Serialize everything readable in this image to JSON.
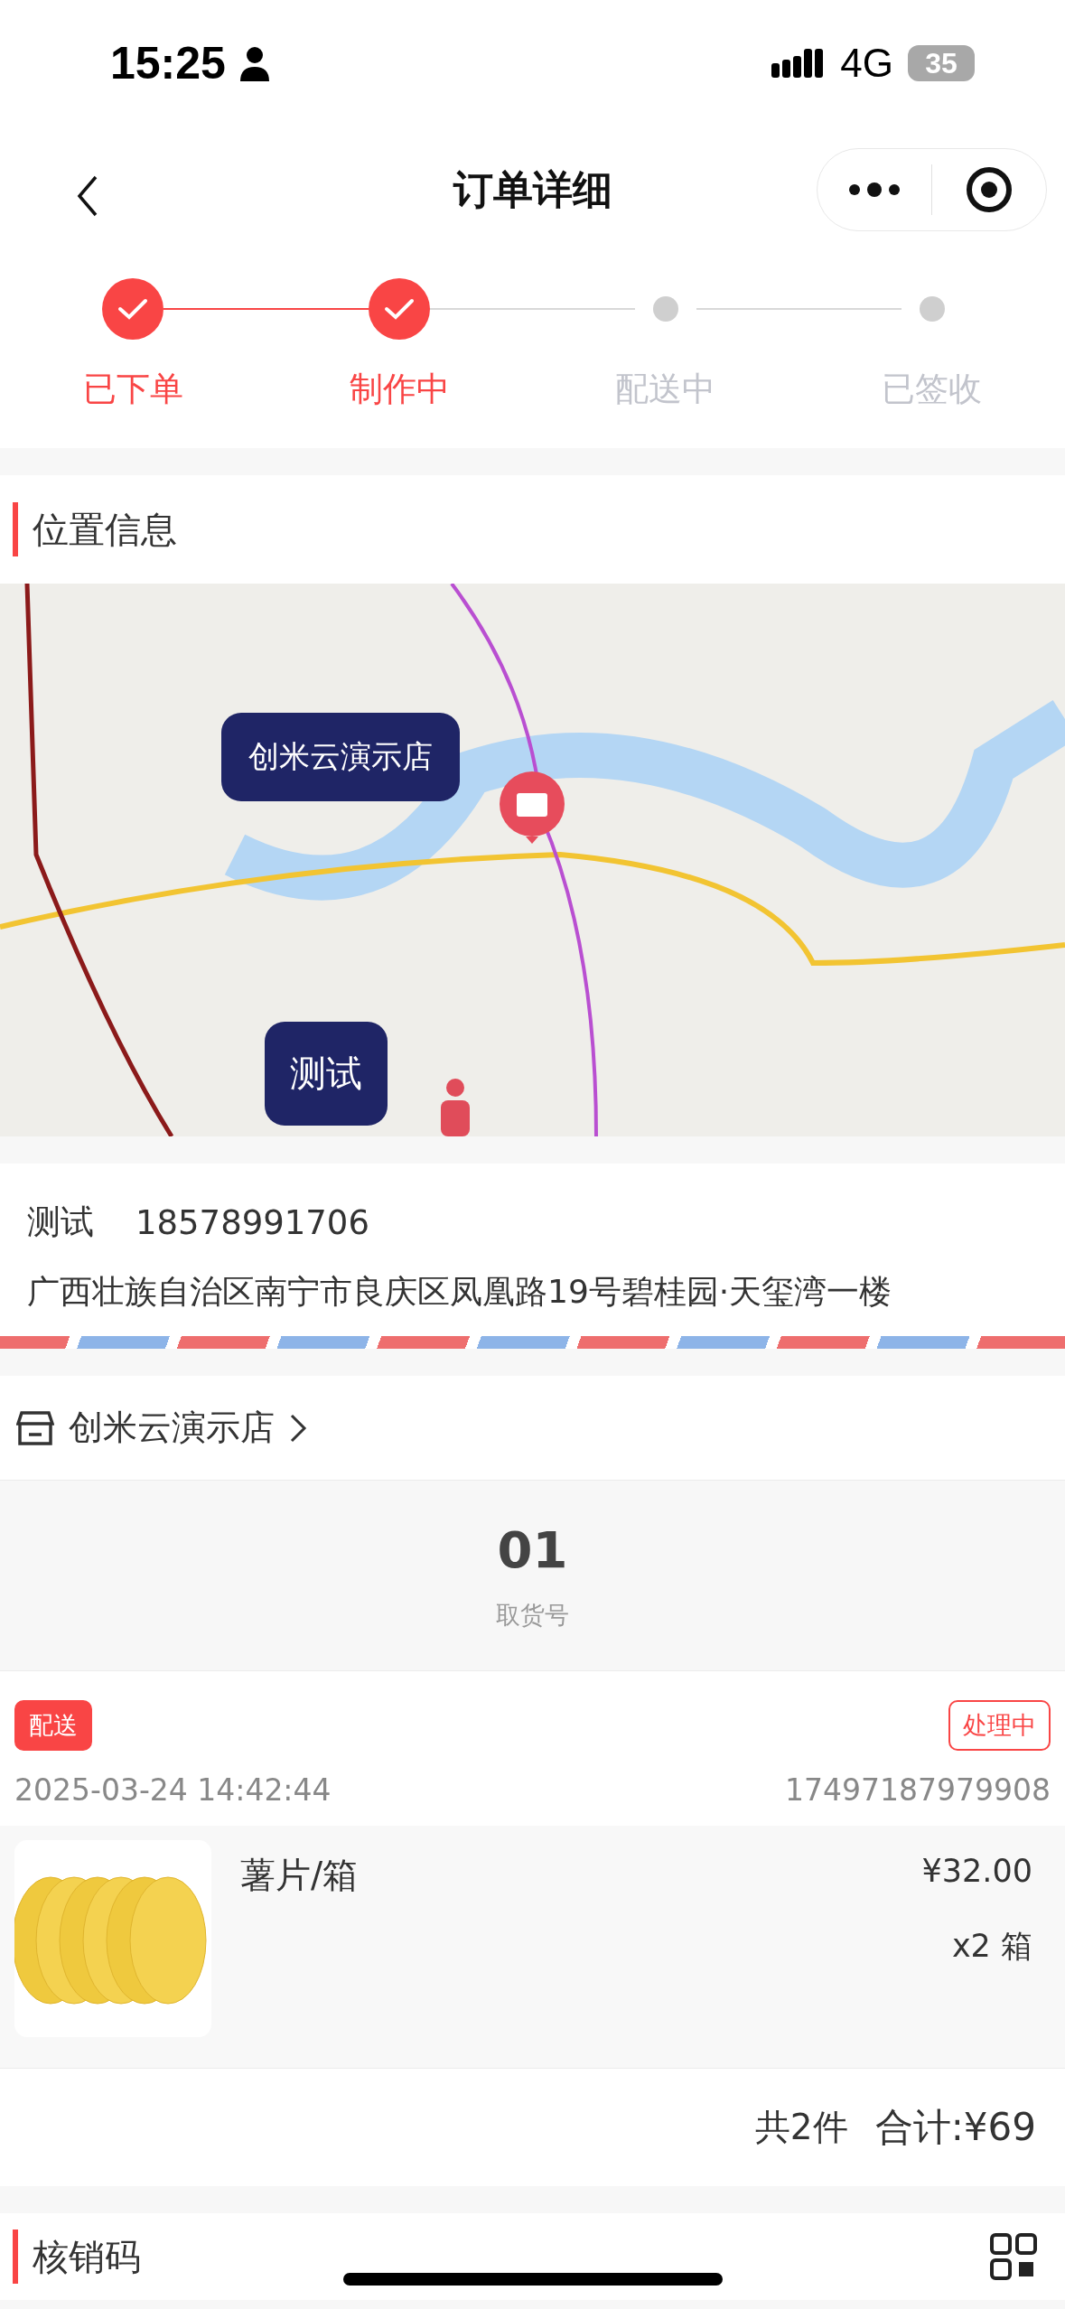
{
  "status_bar": {
    "time": "15:25",
    "network": "4G",
    "battery": "35"
  },
  "nav": {
    "title": "订单详细"
  },
  "steps": [
    {
      "label": "已下单",
      "done": true
    },
    {
      "label": "制作中",
      "done": true
    },
    {
      "label": "配送中",
      "done": false
    },
    {
      "label": "已签收",
      "done": false
    }
  ],
  "location": {
    "title": "位置信息",
    "markers": [
      {
        "label": "创米云演示店",
        "kind": "store"
      },
      {
        "label": "测试",
        "kind": "customer"
      }
    ]
  },
  "contact": {
    "name": "测试",
    "phone": "18578991706",
    "address": "广西壮族自治区南宁市良庆区凤凰路19号碧桂园·天玺湾一楼"
  },
  "store": {
    "name": "创米云演示店"
  },
  "pickup": {
    "number": "01",
    "label": "取货号"
  },
  "order": {
    "delivery_tag": "配送",
    "status": "处理中",
    "time": "2025-03-24 14:42:44",
    "order_no": "17497187979908",
    "items": [
      {
        "name": "薯片/箱",
        "price": "¥32.00",
        "quantity": "x2 箱"
      }
    ],
    "count": "共2件",
    "total": "合计:¥69"
  },
  "verify": {
    "title": "核销码"
  }
}
